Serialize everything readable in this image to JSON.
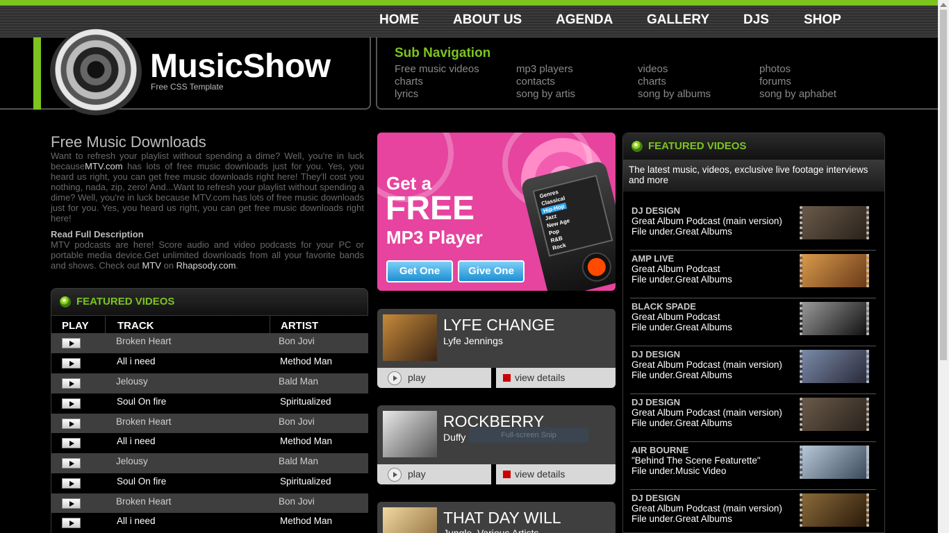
{
  "nav": {
    "items": [
      {
        "label": "HOME"
      },
      {
        "label": "ABOUT US"
      },
      {
        "label": "AGENDA"
      },
      {
        "label": "GALLERY"
      },
      {
        "label": "DJS"
      },
      {
        "label": "SHOP"
      }
    ]
  },
  "logo": {
    "title": "MusicShow",
    "subtitle": "Free CSS Template"
  },
  "subnav": {
    "title": "Sub Navigation",
    "links": [
      "Free music videos",
      "charts",
      "lyrics",
      "mp3 players",
      "contacts",
      "song by artis",
      "videos",
      "charts",
      "song by albums",
      "photos",
      "forums",
      "song by aphabet"
    ]
  },
  "intro": {
    "title": "Free Music Downloads",
    "para1_a": "Want to refresh your playlist without spending a dime? Well, you're in luck because",
    "para1_link": "MTV.com",
    "para1_b": " has lots of free music downloads just for you. Yes, you heard us right, you can get free music downloads right here! They'll cost you nothing, nada, zip, zero! And...Want to refresh your playlist without spending a dime? Well, you're in luck because MTV.com has lots of free music downloads just for you. Yes, you heard us right, you can get free music downloads right here!",
    "read_full": "Read Full Description",
    "para2_a": "MTV podcasts are here! Score audio and video podcasts for your PC or portable media device.Get unlimited downloads from all your favorite bands and shows. Check out ",
    "para2_link1": "MTV",
    "para2_mid": " on ",
    "para2_link2": "Rhapsody.com",
    "para2_end": "."
  },
  "featured_left": {
    "title": "FEATURED VIDEOS",
    "headers": {
      "play": "PLAY",
      "track": "TRACK",
      "artist": "ARTIST"
    },
    "rows": [
      {
        "track": "Broken Heart",
        "artist": "Bon Jovi"
      },
      {
        "track": "All i need",
        "artist": "Method Man"
      },
      {
        "track": "Jelousy",
        "artist": "Bald Man"
      },
      {
        "track": "Soul On fire",
        "artist": "Spiritualized"
      },
      {
        "track": "Broken Heart",
        "artist": "Bon Jovi"
      },
      {
        "track": "All i need",
        "artist": "Method Man"
      },
      {
        "track": "Jelousy",
        "artist": "Bald Man"
      },
      {
        "track": "Soul On fire",
        "artist": "Spiritualized"
      },
      {
        "track": "Broken Heart",
        "artist": "Bon Jovi"
      },
      {
        "track": "All i need",
        "artist": "Method Man"
      }
    ]
  },
  "promo": {
    "line1": "Get a",
    "line2": "FREE",
    "line3": "MP3 Player",
    "btn_get": "Get One",
    "btn_give": "Give One",
    "menu": [
      "Genres",
      "Classical",
      "Hip-Hop",
      "Jazz",
      "New Age",
      "Pop",
      "R&B",
      "Rock"
    ]
  },
  "albums": [
    {
      "title": "LYFE CHANGE",
      "artist": "Lyfe Jennings",
      "play": "play",
      "view": "view details"
    },
    {
      "title": "ROCKBERRY",
      "artist": "Duffy",
      "play": "play",
      "view": "view details"
    },
    {
      "title": "THAT DAY WILL",
      "artist": "Jungle, Various Artists"
    }
  ],
  "snip_tooltip": "Full-screen Snip",
  "featured_right": {
    "title": "FEATURED VIDEOS",
    "desc": "The latest music, videos, exclusive live footage interviews and more",
    "videos": [
      {
        "tag": "DJ DESIGN",
        "title": "Great Album Podcast (main version)",
        "category": "File under.Great Albums"
      },
      {
        "tag": "AMP LIVE",
        "title": "Great Album Podcast",
        "category": "File under.Great Albums"
      },
      {
        "tag": "BLACK SPADE",
        "title": "Great Album Podcast",
        "category": "File under.Great Albums"
      },
      {
        "tag": "DJ DESIGN",
        "title": "Great Album Podcast (main version)",
        "category": "File under.Great Albums"
      },
      {
        "tag": "DJ DESIGN",
        "title": "Great Album Podcast (main version)",
        "category": "File under.Great Albums"
      },
      {
        "tag": "AIR BOURNE",
        "title": "\"Behind The Scene Featurette\"",
        "category": "File under.Music Video"
      },
      {
        "tag": "DJ DESIGN",
        "title": "Great Album Podcast (main version)",
        "category": "File under.Great Albums"
      }
    ]
  },
  "colors": {
    "accent_green": "#7dc41f",
    "promo_pink": "#e6449f",
    "link_red": "#cc0000"
  }
}
